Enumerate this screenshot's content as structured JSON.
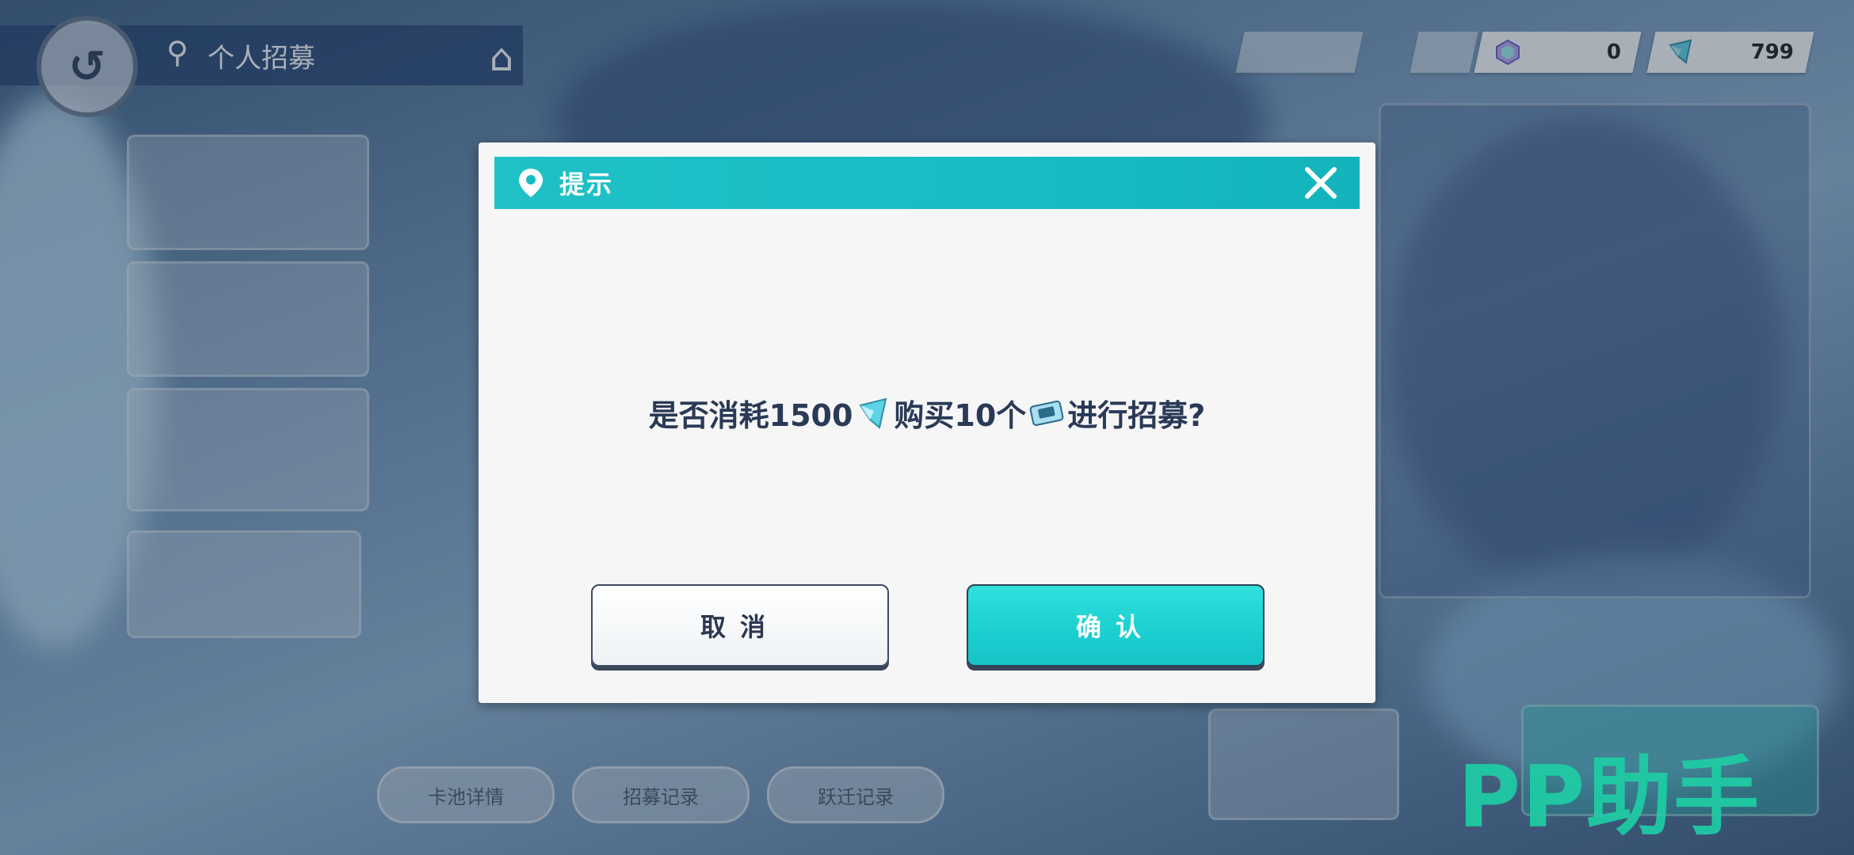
{
  "nav": {
    "title": "个人招募",
    "back_icon": "back-arrow-icon",
    "home_icon": "home-icon"
  },
  "currency": {
    "gem_value": "0",
    "crystal_value": "799"
  },
  "dialog": {
    "title": "提示",
    "message_parts": {
      "p1": "是否消耗1500",
      "p2": "购买10个",
      "p3": "进行招募?"
    },
    "cancel_label": "取消",
    "confirm_label": "确认"
  },
  "bottom_buttons": [
    "卡池详情",
    "招募记录",
    "跃迁记录"
  ],
  "watermark": "PP助手",
  "colors": {
    "header_teal": "#18bcc3",
    "confirm_teal": "#1bcfd0",
    "text_dark": "#2a3a56",
    "watermark_green": "#1ecda5"
  }
}
